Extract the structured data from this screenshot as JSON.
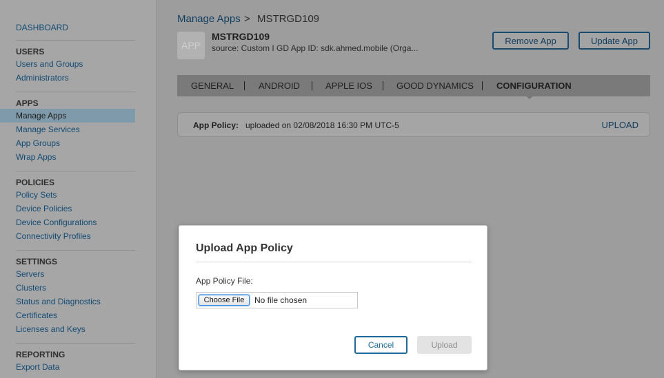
{
  "sidebar": {
    "dashboard": "DASHBOARD",
    "users_heading": "USERS",
    "users_items": [
      "Users and Groups",
      "Administrators"
    ],
    "apps_heading": "APPS",
    "apps_items": [
      "Manage Apps",
      "Manage Services",
      "App Groups",
      "Wrap Apps"
    ],
    "policies_heading": "POLICIES",
    "policies_items": [
      "Policy Sets",
      "Device Policies",
      "Device Configurations",
      "Connectivity Profiles"
    ],
    "settings_heading": "SETTINGS",
    "settings_items": [
      "Servers",
      "Clusters",
      "Status and Diagnostics",
      "Certificates",
      "Licenses and Keys"
    ],
    "reporting_heading": "REPORTING",
    "reporting_items": [
      "Export Data"
    ]
  },
  "breadcrumb": {
    "parent": "Manage Apps",
    "separator": ">",
    "current": "MSTRGD109"
  },
  "app": {
    "icon_text": "APP",
    "name": "MSTRGD109",
    "source": "source: Custom  I GD App ID: sdk.ahmed.mobile (Orga..."
  },
  "header_buttons": {
    "remove": "Remove App",
    "update": "Update App"
  },
  "tabs": [
    "GENERAL",
    "ANDROID",
    "APPLE IOS",
    "GOOD DYNAMICS",
    "CONFIGURATION"
  ],
  "policy": {
    "label": "App Policy:",
    "value": "uploaded on 02/08/2018 16:30 PM UTC-5",
    "action": "UPLOAD"
  },
  "modal": {
    "title": "Upload App Policy",
    "field_label": "App Policy File:",
    "choose_file": "Choose File",
    "file_status": "No file chosen",
    "cancel": "Cancel",
    "upload": "Upload"
  },
  "colors": {
    "link": "#114a73",
    "accent": "#1d6a9a",
    "overlay": "#9b9b9b"
  }
}
